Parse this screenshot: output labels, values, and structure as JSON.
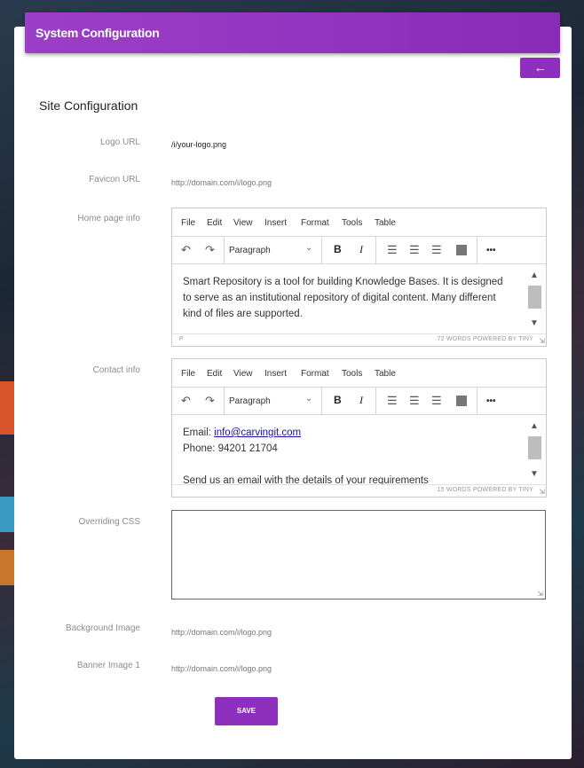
{
  "header": {
    "title": "System Configuration",
    "back_icon": "arrow-left-icon"
  },
  "section": {
    "title": "Site Configuration"
  },
  "fields": {
    "logo": {
      "label": "Logo URL",
      "value": "/i/your-logo.png"
    },
    "favicon": {
      "label": "Favicon URL",
      "value": "http://domain.com/i/logo.png"
    },
    "home_info": {
      "label": "Home page info",
      "text": "Smart Repository is a tool for building Knowledge Bases. It is designed to serve as an institutional repository of digital content. Many different kind of files are supported.",
      "status_path": "P",
      "status_right": "72 WORDS  POWERED BY TINY"
    },
    "contact_info": {
      "label": "Contact info",
      "email_prefix": "Email: ",
      "email_link": "info@carvingit.com",
      "phone": "Phone: 94201 21704",
      "cut_line": "Send us an email with the details of your requirements",
      "status_right": "15 WORDS  POWERED BY TINY"
    },
    "css": {
      "label": "Overriding CSS",
      "value": ""
    },
    "background": {
      "label": "Background Image",
      "value": "http://domain.com/i/logo.png"
    },
    "banner": {
      "label": "Banner Image 1",
      "value": "http://domain.com/i/logo.png"
    }
  },
  "editor": {
    "menu": [
      "File",
      "Edit",
      "View",
      "Insert",
      "Format",
      "Tools",
      "Table"
    ],
    "block_format": "Paragraph",
    "bold_label": "B",
    "italic_label": "I",
    "more_label": "•••"
  },
  "actions": {
    "save_label": "SAVE"
  },
  "colors": {
    "accent": "#8e2fbd"
  }
}
